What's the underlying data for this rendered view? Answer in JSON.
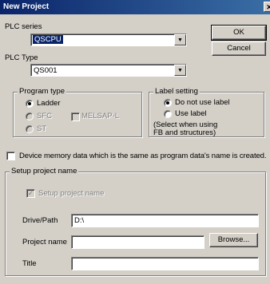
{
  "window": {
    "title": "New Project",
    "close_glyph": "✕"
  },
  "plc_series": {
    "label": "PLC series",
    "value": "QSCPU"
  },
  "plc_type": {
    "label": "PLC Type",
    "value": "QS001"
  },
  "buttons": {
    "ok": "OK",
    "cancel": "Cancel",
    "browse": "Browse..."
  },
  "program_type": {
    "legend": "Program type",
    "ladder": "Ladder",
    "sfc": "SFC",
    "melsap": "MELSAP-L",
    "st": "ST"
  },
  "label_setting": {
    "legend": "Label setting",
    "no_label": "Do not use label",
    "use_label": "Use label",
    "note1": "(Select when using",
    "note2": "FB and structures)"
  },
  "device_memory": {
    "label": "Device memory data which is the same as program data's name is created."
  },
  "setup": {
    "legend": "Setup project name",
    "checkbox_label": "Setup project name",
    "drive_label": "Drive/Path",
    "drive_value": "D:\\",
    "project_label": "Project name",
    "project_value": "",
    "title_label": "Title",
    "title_value": ""
  },
  "icons": {
    "dropdown": "dropdown-arrow-icon",
    "check": "checkmark-icon"
  }
}
